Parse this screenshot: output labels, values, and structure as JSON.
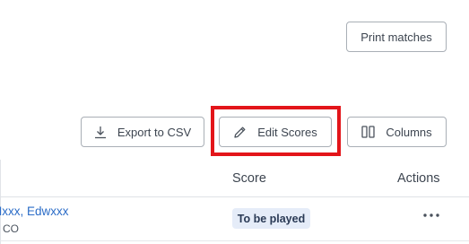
{
  "toolbar": {
    "print_label": "Print matches",
    "export_label": "Export to CSV",
    "edit_scores_label": "Edit Scores",
    "columns_label": "Columns"
  },
  "highlight": {
    "color": "#e3151a",
    "target": "edit-scores-button"
  },
  "table": {
    "columns": [
      "Score",
      "Actions"
    ],
    "rows": [
      {
        "name": "Mxxx, Edwxxx",
        "sub": "CO",
        "score_status": "To be played",
        "actions_icon": "more-horizontal-icon"
      }
    ]
  },
  "icons": {
    "export": "download-icon",
    "edit": "pencil-icon",
    "columns": "columns-icon"
  },
  "colors": {
    "link": "#2b6cc7",
    "badge_bg": "#e5ecf8",
    "border": "#a9afb6"
  }
}
